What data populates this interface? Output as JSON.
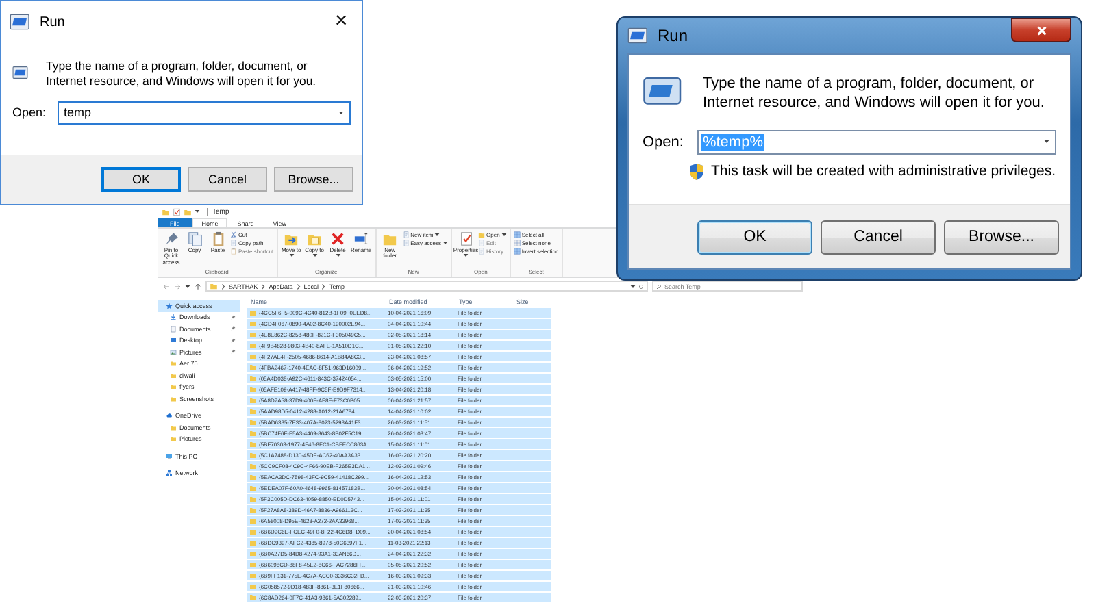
{
  "run_dialog_win10": {
    "title": "Run",
    "close": "×",
    "instructions": "Type the name of a program, folder, document, or Internet resource, and Windows will open it for you.",
    "open_label": "Open:",
    "value": "temp",
    "buttons": [
      {
        "label": "OK",
        "default": true
      },
      {
        "label": "Cancel",
        "default": false
      },
      {
        "label": "Browse...",
        "default": false
      }
    ]
  },
  "run_dialog_win7": {
    "title": "Run",
    "instructions": "Type the name of a program, folder, document, or Internet resource, and Windows will open it for you.",
    "open_label": "Open:",
    "value": "%temp%",
    "value_selected": true,
    "admin_note": "This task will be created with administrative privileges.",
    "buttons": [
      {
        "label": "OK",
        "default": true
      },
      {
        "label": "Cancel",
        "default": false
      },
      {
        "label": "Browse...",
        "default": false
      }
    ]
  },
  "explorer": {
    "title": "Temp",
    "tabs": [
      {
        "label": "File",
        "kind": "file",
        "selected": false
      },
      {
        "label": "Home",
        "kind": "tab",
        "selected": true
      },
      {
        "label": "Share",
        "kind": "tab",
        "selected": false
      },
      {
        "label": "View",
        "kind": "tab",
        "selected": false
      }
    ],
    "ribbon_groups": [
      {
        "label": "Clipboard",
        "large": [
          {
            "label": "Pin to Quick access",
            "kind": "pin",
            "dropdown": false,
            "disabled": false
          },
          {
            "label": "Copy",
            "kind": "copy",
            "dropdown": false,
            "disabled": false
          },
          {
            "label": "Paste",
            "kind": "paste",
            "dropdown": false,
            "disabled": false
          }
        ],
        "small": [
          {
            "label": "Cut",
            "kind": "cut",
            "dropdown": false,
            "disabled": false
          },
          {
            "label": "Copy path",
            "kind": "copy-path",
            "dropdown": false,
            "disabled": false
          },
          {
            "label": "Paste shortcut",
            "kind": "paste",
            "dropdown": false,
            "disabled": true
          }
        ]
      },
      {
        "label": "Organize",
        "large": [
          {
            "label": "Move to",
            "kind": "move",
            "dropdown": true,
            "disabled": false
          },
          {
            "label": "Copy to",
            "kind": "copy-to",
            "dropdown": true,
            "disabled": false
          },
          {
            "label": "Delete",
            "kind": "delete",
            "dropdown": true,
            "disabled": false
          },
          {
            "label": "Rename",
            "kind": "rename",
            "dropdown": false,
            "disabled": false
          }
        ]
      },
      {
        "label": "New",
        "large": [
          {
            "label": "New folder",
            "kind": "folder",
            "dropdown": false,
            "disabled": false
          }
        ],
        "small": [
          {
            "label": "New item",
            "kind": "new-item",
            "dropdown": true,
            "disabled": false
          },
          {
            "label": "Easy access",
            "kind": "easy-access",
            "dropdown": true,
            "disabled": false
          }
        ]
      },
      {
        "label": "Open",
        "large": [
          {
            "label": "Properties",
            "kind": "properties",
            "dropdown": true,
            "disabled": false
          }
        ],
        "small": [
          {
            "label": "Open",
            "kind": "open",
            "dropdown": true,
            "disabled": false
          },
          {
            "label": "Edit",
            "kind": "edit",
            "dropdown": false,
            "disabled": true
          },
          {
            "label": "History",
            "kind": "history",
            "dropdown": false,
            "disabled": true
          }
        ]
      },
      {
        "label": "Select",
        "small": [
          {
            "label": "Select all",
            "kind": "select-all",
            "dropdown": false,
            "disabled": false
          },
          {
            "label": "Select none",
            "kind": "select-none",
            "dropdown": false,
            "disabled": false
          },
          {
            "label": "Invert selection",
            "kind": "invert",
            "dropdown": false,
            "disabled": false
          }
        ]
      }
    ],
    "breadcrumb": [
      "SARTHAK",
      "AppData",
      "Local",
      "Temp"
    ],
    "search": {
      "placeholder": "Search Temp"
    },
    "sidebar": [
      {
        "label": "Quick access",
        "kind": "star",
        "selected": true,
        "pinned": false,
        "children": [
          {
            "label": "Downloads",
            "kind": "download",
            "selected": false,
            "pinned": true
          },
          {
            "label": "Documents",
            "kind": "documents",
            "selected": false,
            "pinned": true
          },
          {
            "label": "Desktop",
            "kind": "desktop",
            "selected": false,
            "pinned": true
          },
          {
            "label": "Pictures",
            "kind": "pictures",
            "selected": false,
            "pinned": true
          },
          {
            "label": "Aer 75",
            "kind": "folder",
            "selected": false,
            "pinned": false
          },
          {
            "label": "diwali",
            "kind": "folder",
            "selected": false,
            "pinned": false
          },
          {
            "label": "flyers",
            "kind": "folder",
            "selected": false,
            "pinned": false
          },
          {
            "label": "Screenshots",
            "kind": "folder",
            "selected": false,
            "pinned": false
          }
        ]
      },
      {
        "label": "OneDrive",
        "kind": "cloud",
        "selected": false,
        "pinned": false,
        "children": [
          {
            "label": "Documents",
            "kind": "folder",
            "selected": false,
            "pinned": false
          },
          {
            "label": "Pictures",
            "kind": "folder",
            "selected": false,
            "pinned": false
          }
        ]
      },
      {
        "label": "This PC",
        "kind": "pc",
        "selected": false,
        "pinned": false
      },
      {
        "label": "Network",
        "kind": "network",
        "selected": false,
        "pinned": false
      }
    ],
    "columns": [
      "Name",
      "Date modified",
      "Type",
      "Size"
    ],
    "rows": [
      {
        "name": "{4CC5F6F5-009C-4C40-812B-1F09F0EED8...",
        "date": "10-04-2021 16:09",
        "type": "File folder",
        "selected": true
      },
      {
        "name": "{4CD4F067-0890-4A02-8C40-190002E94...",
        "date": "04-04-2021 10:44",
        "type": "File folder",
        "selected": true
      },
      {
        "name": "{4E8E862C-8258-480F-821C-F305049C5...",
        "date": "02-05-2021 18:14",
        "type": "File folder",
        "selected": true
      },
      {
        "name": "{4F9B4828-9803-4B40-8AFE-1A510D1C...",
        "date": "01-05-2021 22:10",
        "type": "File folder",
        "selected": true
      },
      {
        "name": "{4F27AE4F-2505-4686-8614-A1B84A8C3...",
        "date": "23-04-2021 08:57",
        "type": "File folder",
        "selected": true
      },
      {
        "name": "{4FBA2467-1740-4EAC-8F51-963D16009...",
        "date": "06-04-2021 19:52",
        "type": "File folder",
        "selected": true
      },
      {
        "name": "{05A4D038-A92C-4611-843C-37424054...",
        "date": "03-05-2021 15:00",
        "type": "File folder",
        "selected": true
      },
      {
        "name": "{05AFE109-A417-48FF-9C5F-E9D9F7314...",
        "date": "13-04-2021 20:18",
        "type": "File folder",
        "selected": true
      },
      {
        "name": "{5A8D7A58-37D9-400F-AF8F-F73C0B05...",
        "date": "06-04-2021 21:57",
        "type": "File folder",
        "selected": true
      },
      {
        "name": "{5AAD98D5-0412-4288-A012-21A6784...",
        "date": "14-04-2021 10:02",
        "type": "File folder",
        "selected": true
      },
      {
        "name": "{5BAD6385-7E33-407A-8023-5293A41F3...",
        "date": "26-03-2021 11:51",
        "type": "File folder",
        "selected": true
      },
      {
        "name": "{5BC74F6F-F5A3-4409-8643-8B02F5C19...",
        "date": "26-04-2021 08:47",
        "type": "File folder",
        "selected": true
      },
      {
        "name": "{5BF70303-1977-4F46-8FC1-CBFECC863A...",
        "date": "15-04-2021 11:01",
        "type": "File folder",
        "selected": true
      },
      {
        "name": "{5C1A7488-D130-45DF-AC62-40AA3A33...",
        "date": "16-03-2021 20:20",
        "type": "File folder",
        "selected": true
      },
      {
        "name": "{5CC9CF08-4C9C-4F66-90EB-F265E3DA1...",
        "date": "12-03-2021 09:46",
        "type": "File folder",
        "selected": true
      },
      {
        "name": "{5EACA3DC-7598-43FC-9C59-41418C299...",
        "date": "16-04-2021 12:53",
        "type": "File folder",
        "selected": true
      },
      {
        "name": "{5EDEA07F-60A0-4648-9965-81457183B...",
        "date": "20-04-2021 08:54",
        "type": "File folder",
        "selected": true
      },
      {
        "name": "{5F3C005D-DC63-4059-8850-ED0D5743...",
        "date": "15-04-2021 11:01",
        "type": "File folder",
        "selected": true
      },
      {
        "name": "{5F27A8A8-389D-46A7-8836-A966113C...",
        "date": "17-03-2021 11:35",
        "type": "File folder",
        "selected": true
      },
      {
        "name": "{6A58008-D95E-4628-A272-2AA33968...",
        "date": "17-03-2021 11:35",
        "type": "File folder",
        "selected": true
      },
      {
        "name": "{6B6D9C6E-FCEC-49F0-8F22-4C6D8FD09...",
        "date": "20-04-2021 08:54",
        "type": "File folder",
        "selected": true
      },
      {
        "name": "{6BDC9397-AFC2-4385-8978-50C6397F1...",
        "date": "11-03-2021 22:13",
        "type": "File folder",
        "selected": true
      },
      {
        "name": "{6B0A27D5-84D8-4274-93A1-33AN66D...",
        "date": "24-04-2021 22:32",
        "type": "File folder",
        "selected": true
      },
      {
        "name": "{6B6098CD-88F8-45E2-8C66-FAC7286FF...",
        "date": "05-05-2021 20:52",
        "type": "File folder",
        "selected": true
      },
      {
        "name": "{6B9FF131-775E-4C7A-ACC0-3336C32FD...",
        "date": "16-03-2021 09:33",
        "type": "File folder",
        "selected": true
      },
      {
        "name": "{6C058572-9D18-483F-8861-3E1F80666...",
        "date": "21-03-2021 10:46",
        "type": "File folder",
        "selected": true
      },
      {
        "name": "{6C8AD264-0F7C-41A3-9861-5A302289...",
        "date": "22-03-2021 20:37",
        "type": "File folder",
        "selected": true
      }
    ]
  }
}
